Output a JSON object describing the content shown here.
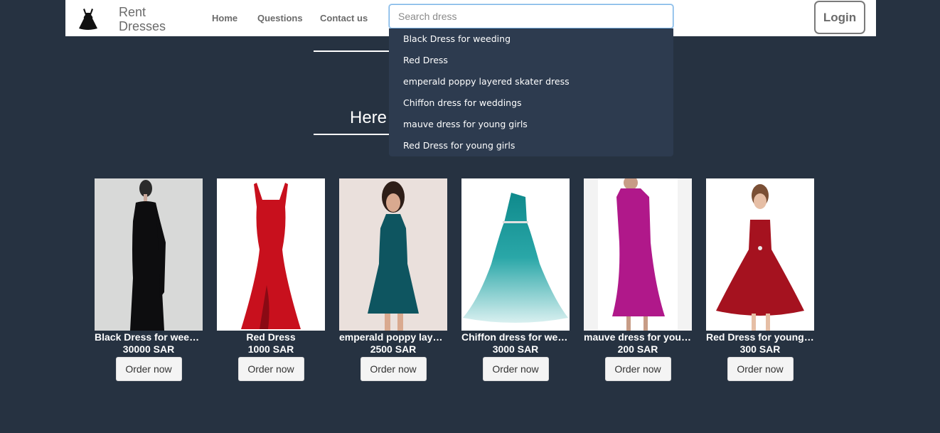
{
  "navbar": {
    "brand_line1": "Rent",
    "brand_line2": "Dresses",
    "logo_icon": "dress-icon",
    "links": {
      "home": "Home",
      "questions": "Questions",
      "contact": "Contact us"
    },
    "search_placeholder": "Search dress",
    "login_label": "Login"
  },
  "section": {
    "title_partial": "Here"
  },
  "dropdown": {
    "items": [
      "Black Dress for weeding",
      "Red Dress",
      "emperald poppy layered skater dress",
      "Chiffon dress for weddings",
      "mauve dress for young girls",
      "Red Dress for young girls"
    ]
  },
  "products": [
    {
      "name": "Black Dress for weeding",
      "price": "30000 SAR",
      "button": "Order now",
      "color": "#0d0d0f"
    },
    {
      "name": "Red Dress",
      "price": "1000 SAR",
      "button": "Order now",
      "color": "#c8101d"
    },
    {
      "name": "emperald poppy layered skater dress",
      "price": "2500 SAR",
      "button": "Order now",
      "color": "#0e5560"
    },
    {
      "name": "Chiffon dress for weddings",
      "price": "3000 SAR",
      "button": "Order now",
      "color": "#1b9a9c"
    },
    {
      "name": "mauve dress for young girls",
      "price": "200 SAR",
      "button": "Order now",
      "color": "#b0188a"
    },
    {
      "name": "Red Dress for young girls",
      "price": "300 SAR",
      "button": "Order now",
      "color": "#a5121f"
    }
  ],
  "colors": {
    "background": "#263241",
    "dropdown": "#2d3b4f",
    "navbar": "#ffffff"
  }
}
